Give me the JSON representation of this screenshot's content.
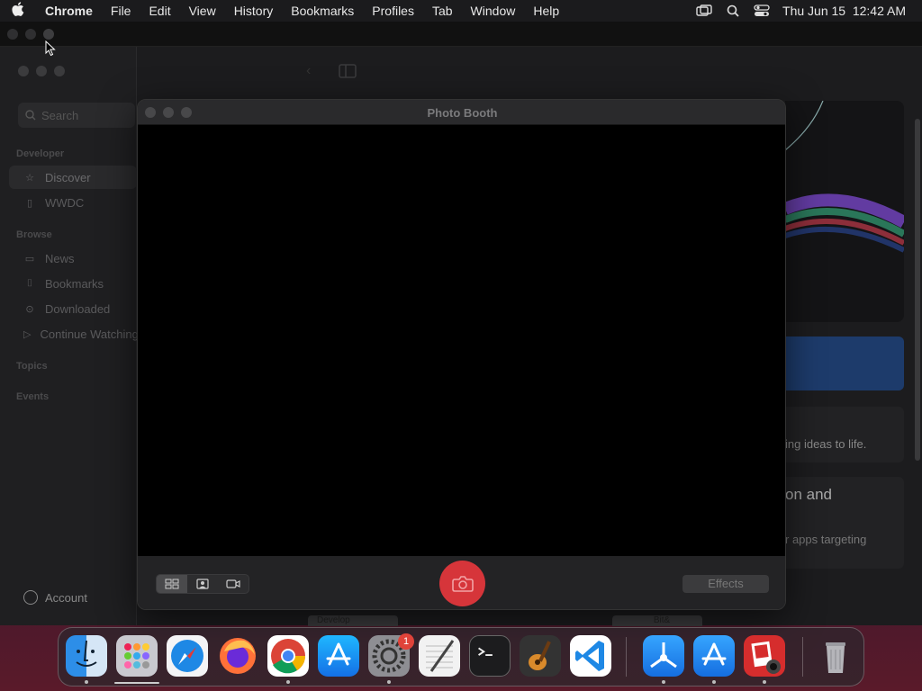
{
  "menubar": {
    "app_name": "Chrome",
    "items": [
      "File",
      "Edit",
      "View",
      "History",
      "Bookmarks",
      "Profiles",
      "Tab",
      "Window",
      "Help"
    ],
    "clock": "Thu Jun 15  12:42 AM",
    "status_icons": [
      "screen-mirroring-icon",
      "spotlight-search-icon",
      "control-center-icon"
    ]
  },
  "developer_window": {
    "search_placeholder": "Search",
    "sections": {
      "developer": "Developer",
      "browse": "Browse",
      "topics": "Topics",
      "events": "Events"
    },
    "developer_items": [
      {
        "label": "Discover",
        "icon": "star-icon"
      },
      {
        "label": "WWDC",
        "icon": "wwdc-icon"
      }
    ],
    "browse_items": [
      {
        "label": "News",
        "icon": "news-icon"
      },
      {
        "label": "Bookmarks",
        "icon": "bookmark-icon"
      },
      {
        "label": "Downloaded",
        "icon": "download-icon"
      },
      {
        "label": "Continue Watching",
        "icon": "play-icon"
      }
    ],
    "account_label": "Account",
    "card_text_1": "ing ideas to life.",
    "card_heading_2": "on and",
    "card_text_2": "r apps targeting",
    "bottom_tab_1": "Develop",
    "bottom_tab_2": "Bit&"
  },
  "photo_booth": {
    "title": "Photo Booth",
    "view_modes": [
      "grid-view-icon",
      "single-photo-icon",
      "video-icon"
    ],
    "shutter_icon": "camera-icon",
    "effects_label": "Effects"
  },
  "dock": {
    "apps": [
      {
        "name": "Finder",
        "icon": "finder-icon",
        "running": true
      },
      {
        "name": "Launchpad",
        "icon": "launchpad-icon",
        "running": false
      },
      {
        "name": "Safari",
        "icon": "safari-icon",
        "running": false
      },
      {
        "name": "Firefox",
        "icon": "firefox-icon",
        "running": false
      },
      {
        "name": "Google Chrome",
        "icon": "chrome-icon",
        "running": true
      },
      {
        "name": "App Store",
        "icon": "app-store-icon",
        "running": false
      },
      {
        "name": "System Settings",
        "icon": "settings-icon",
        "running": true,
        "badge": "1"
      },
      {
        "name": "TextEdit",
        "icon": "textedit-icon",
        "running": false
      },
      {
        "name": "Terminal",
        "icon": "terminal-icon",
        "running": false
      },
      {
        "name": "GarageBand",
        "icon": "garageband-icon",
        "running": false
      },
      {
        "name": "Visual Studio Code",
        "icon": "vscode-icon",
        "running": false
      },
      {
        "name": "Xcode Instruments",
        "icon": "instruments-icon",
        "running": true
      },
      {
        "name": "App Store Connect",
        "icon": "app-store-2-icon",
        "running": true
      },
      {
        "name": "Photo Booth",
        "icon": "photo-booth-icon",
        "running": true
      },
      {
        "name": "Trash",
        "icon": "trash-icon",
        "running": false
      }
    ]
  }
}
